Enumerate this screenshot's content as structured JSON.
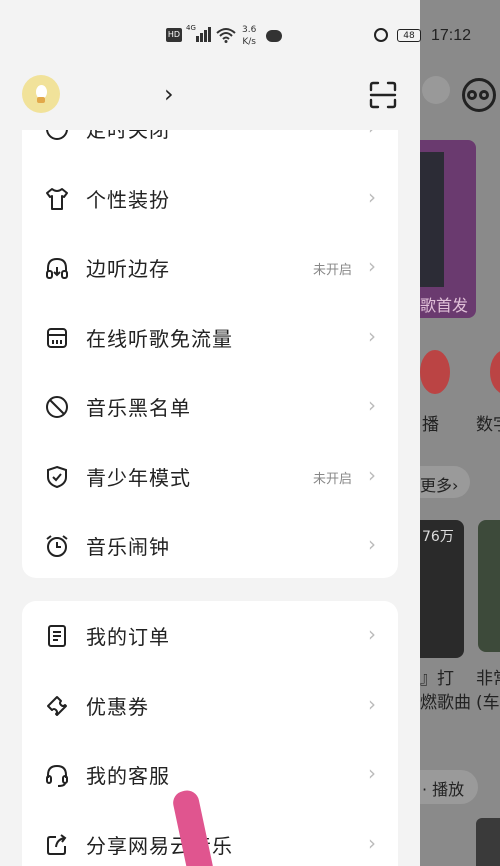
{
  "status_bar": {
    "network_badge": "HD",
    "signal_type": "4G",
    "speed_value": "3.6",
    "speed_unit": "K/s",
    "battery": "48",
    "time": "17:12"
  },
  "header": {
    "chevron": "›"
  },
  "menu_group_1": [
    {
      "label": "定时关闭",
      "status": "",
      "icon": "clock-icon"
    },
    {
      "label": "个性装扮",
      "status": "",
      "icon": "tshirt-icon"
    },
    {
      "label": "边听边存",
      "status": "未开启",
      "icon": "headphones-icon"
    },
    {
      "label": "在线听歌免流量",
      "status": "",
      "icon": "sim-card-icon"
    },
    {
      "label": "音乐黑名单",
      "status": "",
      "icon": "block-icon"
    },
    {
      "label": "青少年模式",
      "status": "未开启",
      "icon": "shield-check-icon"
    },
    {
      "label": "音乐闹钟",
      "status": "",
      "icon": "alarm-clock-icon"
    }
  ],
  "menu_group_2": [
    {
      "label": "我的订单",
      "status": "",
      "icon": "order-icon"
    },
    {
      "label": "优惠券",
      "status": "",
      "icon": "coupon-icon"
    },
    {
      "label": "我的客服",
      "status": "",
      "icon": "headset-icon"
    },
    {
      "label": "分享网易云音乐",
      "status": "",
      "icon": "share-icon"
    }
  ],
  "arrow_glyph": "›",
  "background": {
    "banner_text": "歌首发",
    "live_label": "播",
    "digital_label": "数字",
    "more_label": "更多›",
    "count_label": "76万",
    "song_text_1": "』打",
    "song_text_2": "燃歌曲",
    "song_text_3": "非常",
    "song_text_4": "(车",
    "play_label": "· 播放"
  }
}
